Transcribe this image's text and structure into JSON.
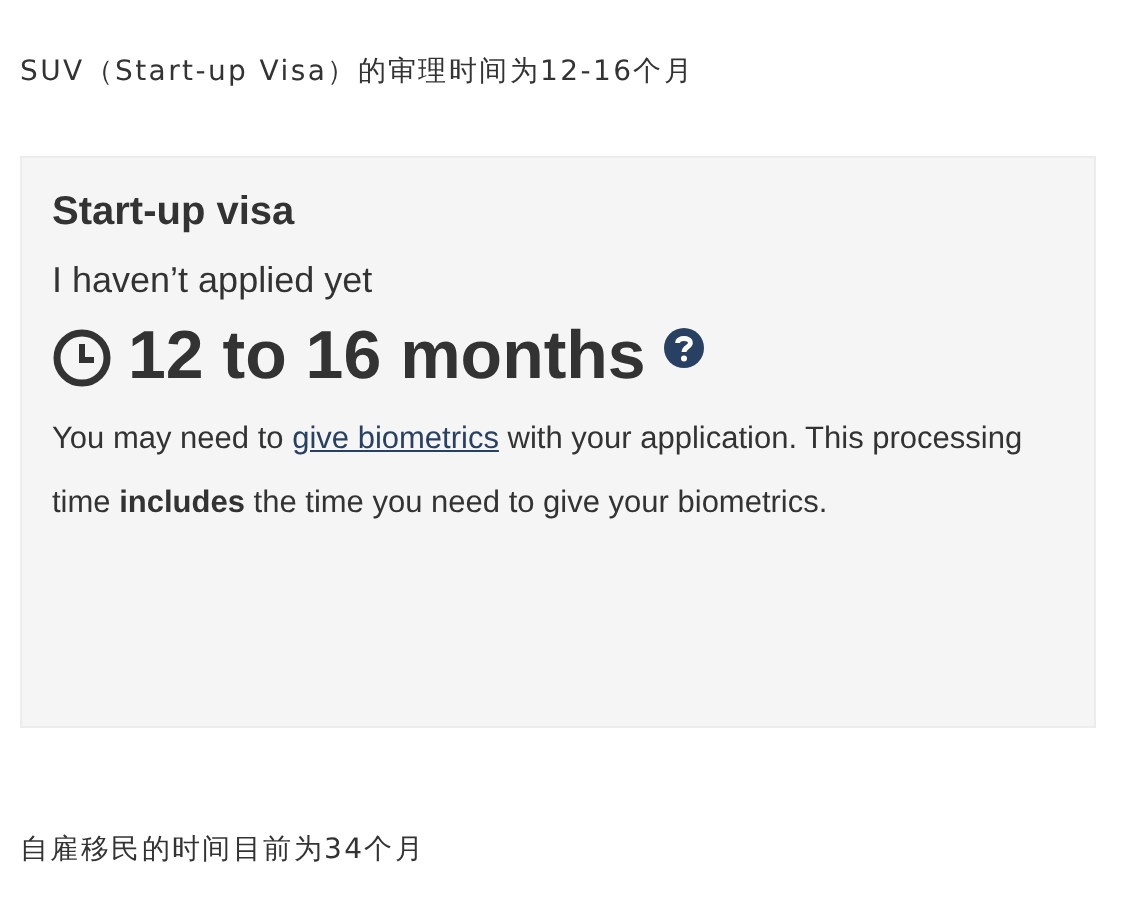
{
  "intro_text": "SUV（Start-up Visa）的审理时间为12-16个月",
  "card": {
    "title": "Start-up visa",
    "status": "I haven’t applied yet",
    "processing_time": "12 to 16 months",
    "note": {
      "before": "You may need to ",
      "link": "give biometrics",
      "after": " with your application. This processing time **includes** the time you need to give your biometrics."
    }
  },
  "outro_text": "自雇移民的时间目前为34个月"
}
